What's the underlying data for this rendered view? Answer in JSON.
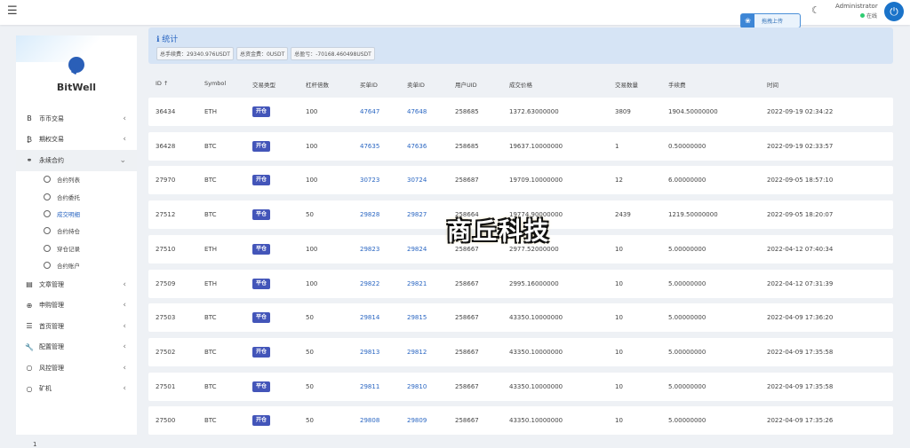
{
  "topbar": {
    "menu_icon": "hamburger-icon",
    "upload_label": "拖拽上传",
    "admin_name": "Administrator",
    "admin_status": "在线"
  },
  "sidebar": {
    "brand": "BitWell",
    "items": [
      {
        "icon": "bitcoin-icon",
        "glyph": "B",
        "label": "币币交易",
        "chevron": "‹"
      },
      {
        "icon": "options-icon",
        "glyph": "₿",
        "label": "期权交易",
        "chevron": "‹"
      },
      {
        "icon": "link-icon",
        "glyph": "⚭",
        "label": "永续合约",
        "chevron": "⌄"
      }
    ],
    "sub_items": [
      "合约列表",
      "合约委托",
      "成交明细",
      "合约持仓",
      "穿仓记录",
      "合约账户"
    ],
    "items2": [
      {
        "icon": "article-icon",
        "glyph": "▤",
        "label": "文章管理",
        "chevron": "‹"
      },
      {
        "icon": "lifebuoy-icon",
        "glyph": "⊕",
        "label": "申购管理",
        "chevron": "‹"
      },
      {
        "icon": "homepage-icon",
        "glyph": "☰",
        "label": "首页管理",
        "chevron": "‹"
      },
      {
        "icon": "wrench-icon",
        "glyph": "🔧",
        "label": "配置管理",
        "chevron": "‹"
      },
      {
        "icon": "risk-icon",
        "glyph": "○",
        "label": "风控管理",
        "chevron": "‹"
      },
      {
        "icon": "mining-icon",
        "glyph": "○",
        "label": "矿机",
        "chevron": "‹"
      }
    ],
    "page_number": "1"
  },
  "stats": {
    "title": "统计",
    "tags": [
      "总手续费：29340.976USDT",
      "总资金费：0USDT",
      "总盈亏：-70168.460498USDT"
    ]
  },
  "table": {
    "headers": [
      "ID ↑",
      "Symbol",
      "交易类型",
      "杠杆倍数",
      "买单ID",
      "卖单ID",
      "用户UID",
      "成交价格",
      "交易数量",
      "手续费",
      "时间"
    ],
    "rows": [
      [
        "36434",
        "ETH",
        "开仓",
        "100",
        "47647",
        "47648",
        "258685",
        "1372.63000000",
        "3809",
        "1904.50000000",
        "2022-09-19 02:34:22"
      ],
      [
        "36428",
        "BTC",
        "开仓",
        "100",
        "47635",
        "47636",
        "258685",
        "19637.10000000",
        "1",
        "0.50000000",
        "2022-09-19 02:33:57"
      ],
      [
        "27970",
        "BTC",
        "开仓",
        "100",
        "30723",
        "30724",
        "258687",
        "19709.10000000",
        "12",
        "6.00000000",
        "2022-09-05 18:57:10"
      ],
      [
        "27512",
        "BTC",
        "平仓",
        "50",
        "29828",
        "29827",
        "258664",
        "19774.90000000",
        "2439",
        "1219.50000000",
        "2022-09-05 18:20:07"
      ],
      [
        "27510",
        "ETH",
        "平仓",
        "100",
        "29823",
        "29824",
        "258667",
        "2977.52000000",
        "10",
        "5.00000000",
        "2022-04-12 07:40:34"
      ],
      [
        "27509",
        "ETH",
        "平仓",
        "100",
        "29822",
        "29821",
        "258667",
        "2995.16000000",
        "10",
        "5.00000000",
        "2022-04-12 07:31:39"
      ],
      [
        "27503",
        "BTC",
        "平仓",
        "50",
        "29814",
        "29815",
        "258667",
        "43350.10000000",
        "10",
        "5.00000000",
        "2022-04-09 17:36:20"
      ],
      [
        "27502",
        "BTC",
        "开仓",
        "50",
        "29813",
        "29812",
        "258667",
        "43350.10000000",
        "10",
        "5.00000000",
        "2022-04-09 17:35:58"
      ],
      [
        "27501",
        "BTC",
        "平仓",
        "50",
        "29811",
        "29810",
        "258667",
        "43350.10000000",
        "10",
        "5.00000000",
        "2022-04-09 17:35:58"
      ],
      [
        "27500",
        "BTC",
        "开仓",
        "50",
        "29808",
        "29809",
        "258667",
        "43350.10000000",
        "10",
        "5.00000000",
        "2022-04-09 17:35:26"
      ]
    ]
  },
  "watermark": "商丘科技"
}
